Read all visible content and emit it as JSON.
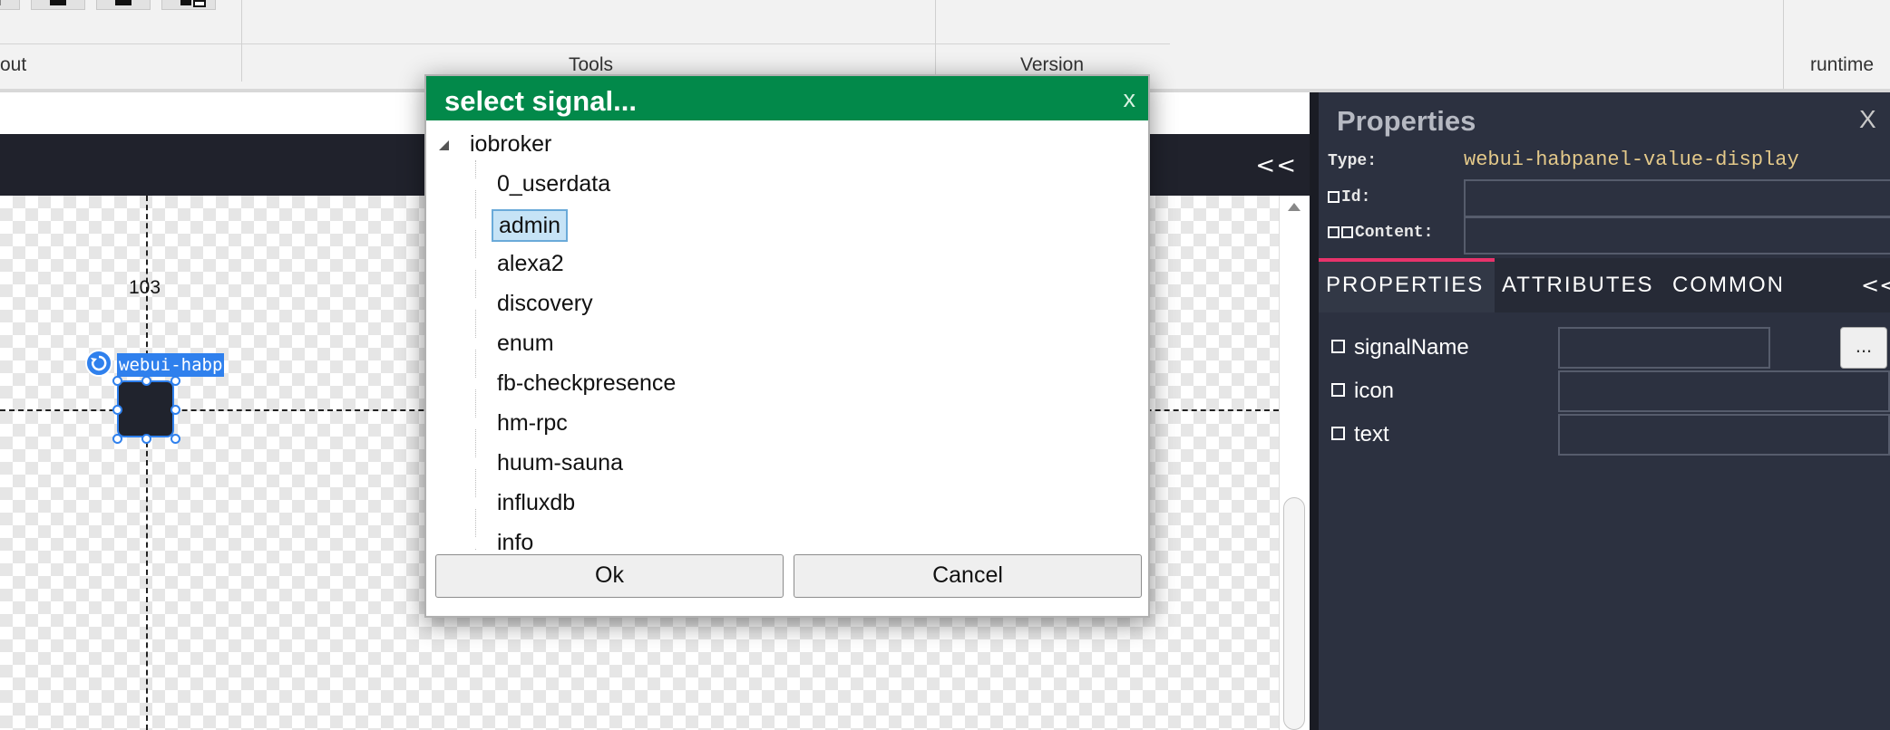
{
  "ribbon": {
    "groups": [
      "out",
      "Tools",
      "Version",
      "runtime"
    ]
  },
  "designer": {
    "collapse_label": "<<",
    "dimension_label": "103",
    "element_tag": "webui-habp"
  },
  "properties_panel": {
    "title": "Properties",
    "close_label": "X",
    "type_label": "Type:",
    "type_value": "webui-habpanel-value-display",
    "id_label": "Id:",
    "id_value": "",
    "content_label": "Content:",
    "content_value": "",
    "tabs": [
      "PROPERTIES",
      "ATTRIBUTES",
      "COMMON"
    ],
    "active_tab": "PROPERTIES",
    "tabs_collapse_label": "<<",
    "rows": [
      {
        "label": "signalName",
        "value": ""
      },
      {
        "label": "icon",
        "value": ""
      },
      {
        "label": "text",
        "value": ""
      }
    ],
    "browse_label": "..."
  },
  "dialog": {
    "title": "select signal...",
    "close_label": "x",
    "tree": {
      "root": "iobroker",
      "children": [
        "0_userdata",
        "admin",
        "alexa2",
        "discovery",
        "enum",
        "fb-checkpresence",
        "hm-rpc",
        "huum-sauna",
        "influxdb",
        "info"
      ],
      "selected": "admin"
    },
    "ok_label": "Ok",
    "cancel_label": "Cancel"
  },
  "colors": {
    "dialog_header": "#02894a",
    "selection_blue": "#2f80ed",
    "tab_accent": "#e8336b",
    "panel_bg": "#2c3140",
    "type_value_color": "#e4c98a"
  }
}
